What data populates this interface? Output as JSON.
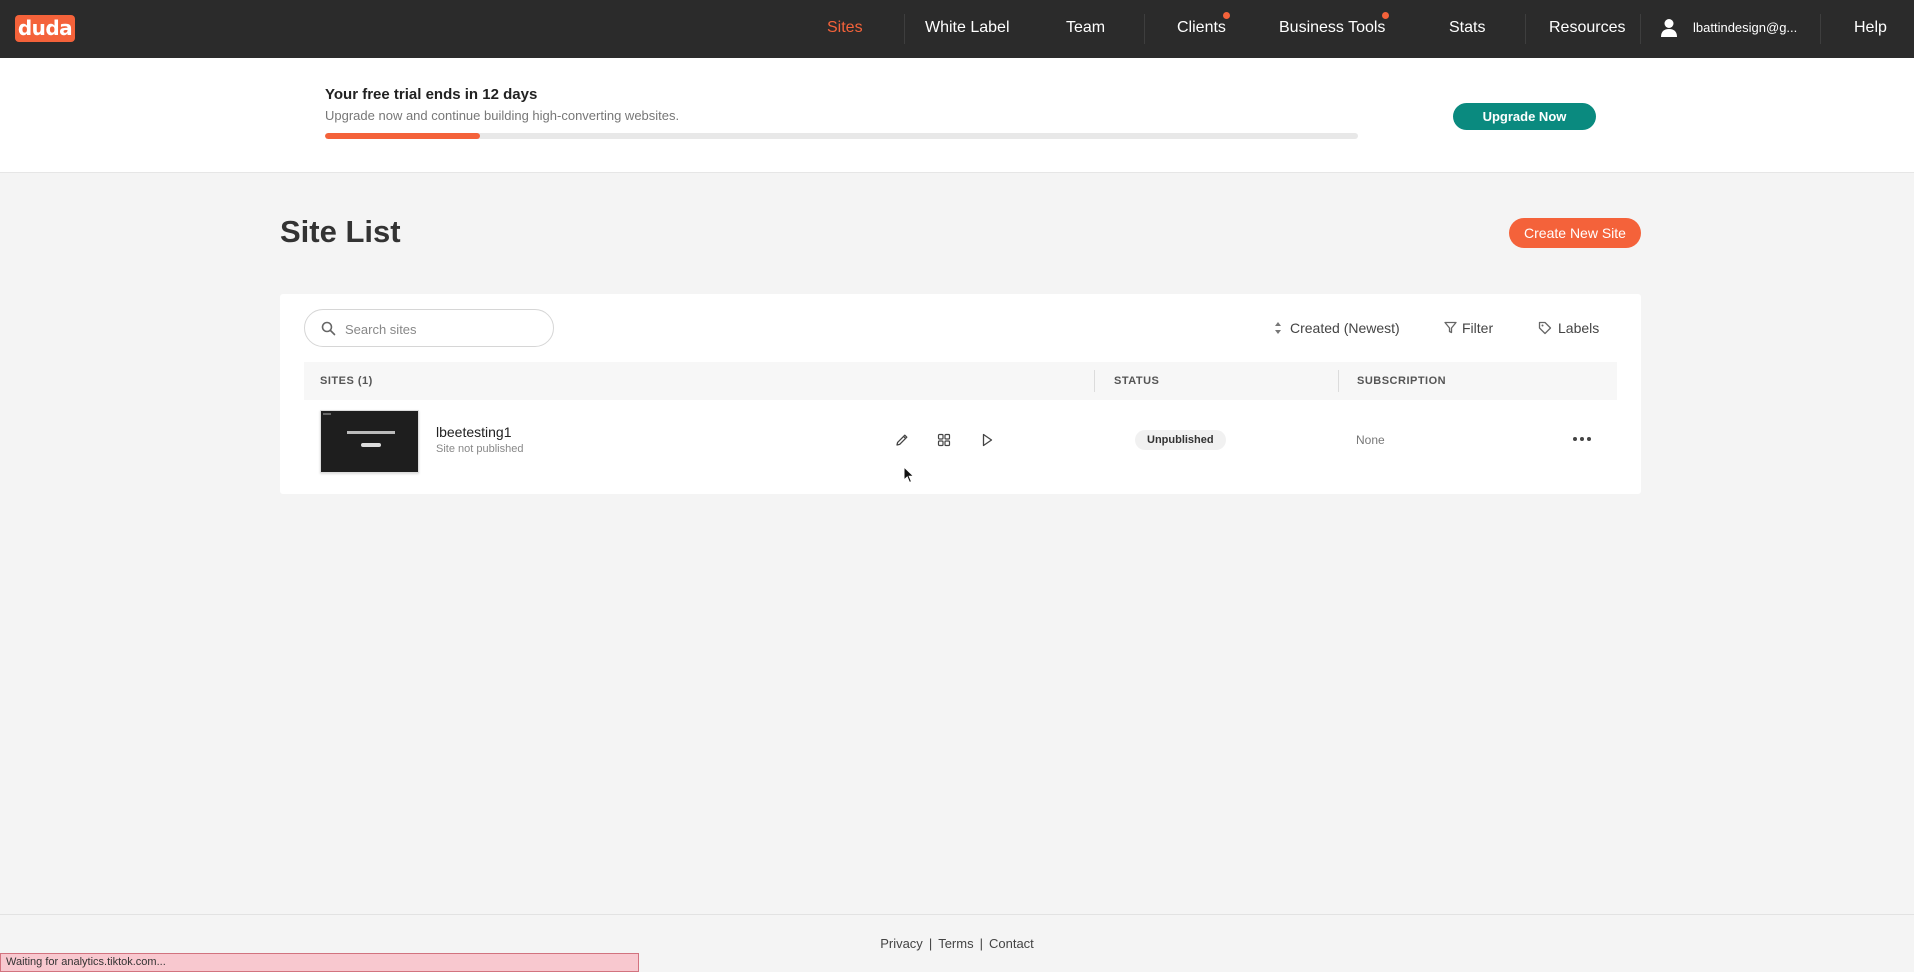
{
  "brand": {
    "logo_text": "duda",
    "accent_color": "#f4623a",
    "secondary_color": "#0a8a7f"
  },
  "nav": {
    "items": [
      {
        "label": "Sites",
        "active": true
      },
      {
        "label": "White Label"
      },
      {
        "label": "Team"
      },
      {
        "label": "Clients",
        "has_notification": true
      },
      {
        "label": "Business Tools",
        "has_notification": true
      },
      {
        "label": "Stats"
      },
      {
        "label": "Resources"
      }
    ],
    "user_email": "lbattindesign@g...",
    "help_label": "Help",
    "user_icon": "user-icon"
  },
  "trial_banner": {
    "title": "Your free trial ends in 12 days",
    "subtitle": "Upgrade now and continue building high-converting websites.",
    "progress_fraction": 0.15,
    "upgrade_label": "Upgrade Now"
  },
  "page": {
    "title": "Site List",
    "create_label": "Create New Site"
  },
  "toolbar": {
    "search_placeholder": "Search sites",
    "sort_label": "Created (Newest)",
    "filter_label": "Filter",
    "labels_label": "Labels"
  },
  "table": {
    "headers": {
      "sites": "SITES (1)",
      "status": "STATUS",
      "subscription": "SUBSCRIPTION"
    },
    "rows": [
      {
        "name": "lbeetesting1",
        "sub": "Site not published",
        "status": "Unpublished",
        "subscription": "None",
        "actions": [
          "edit-icon",
          "grid-icon",
          "preview-icon"
        ]
      }
    ]
  },
  "footer": {
    "privacy": "Privacy",
    "terms": "Terms",
    "contact": "Contact",
    "separator": "|"
  },
  "status_bar": {
    "text": "Waiting for analytics.tiktok.com..."
  }
}
